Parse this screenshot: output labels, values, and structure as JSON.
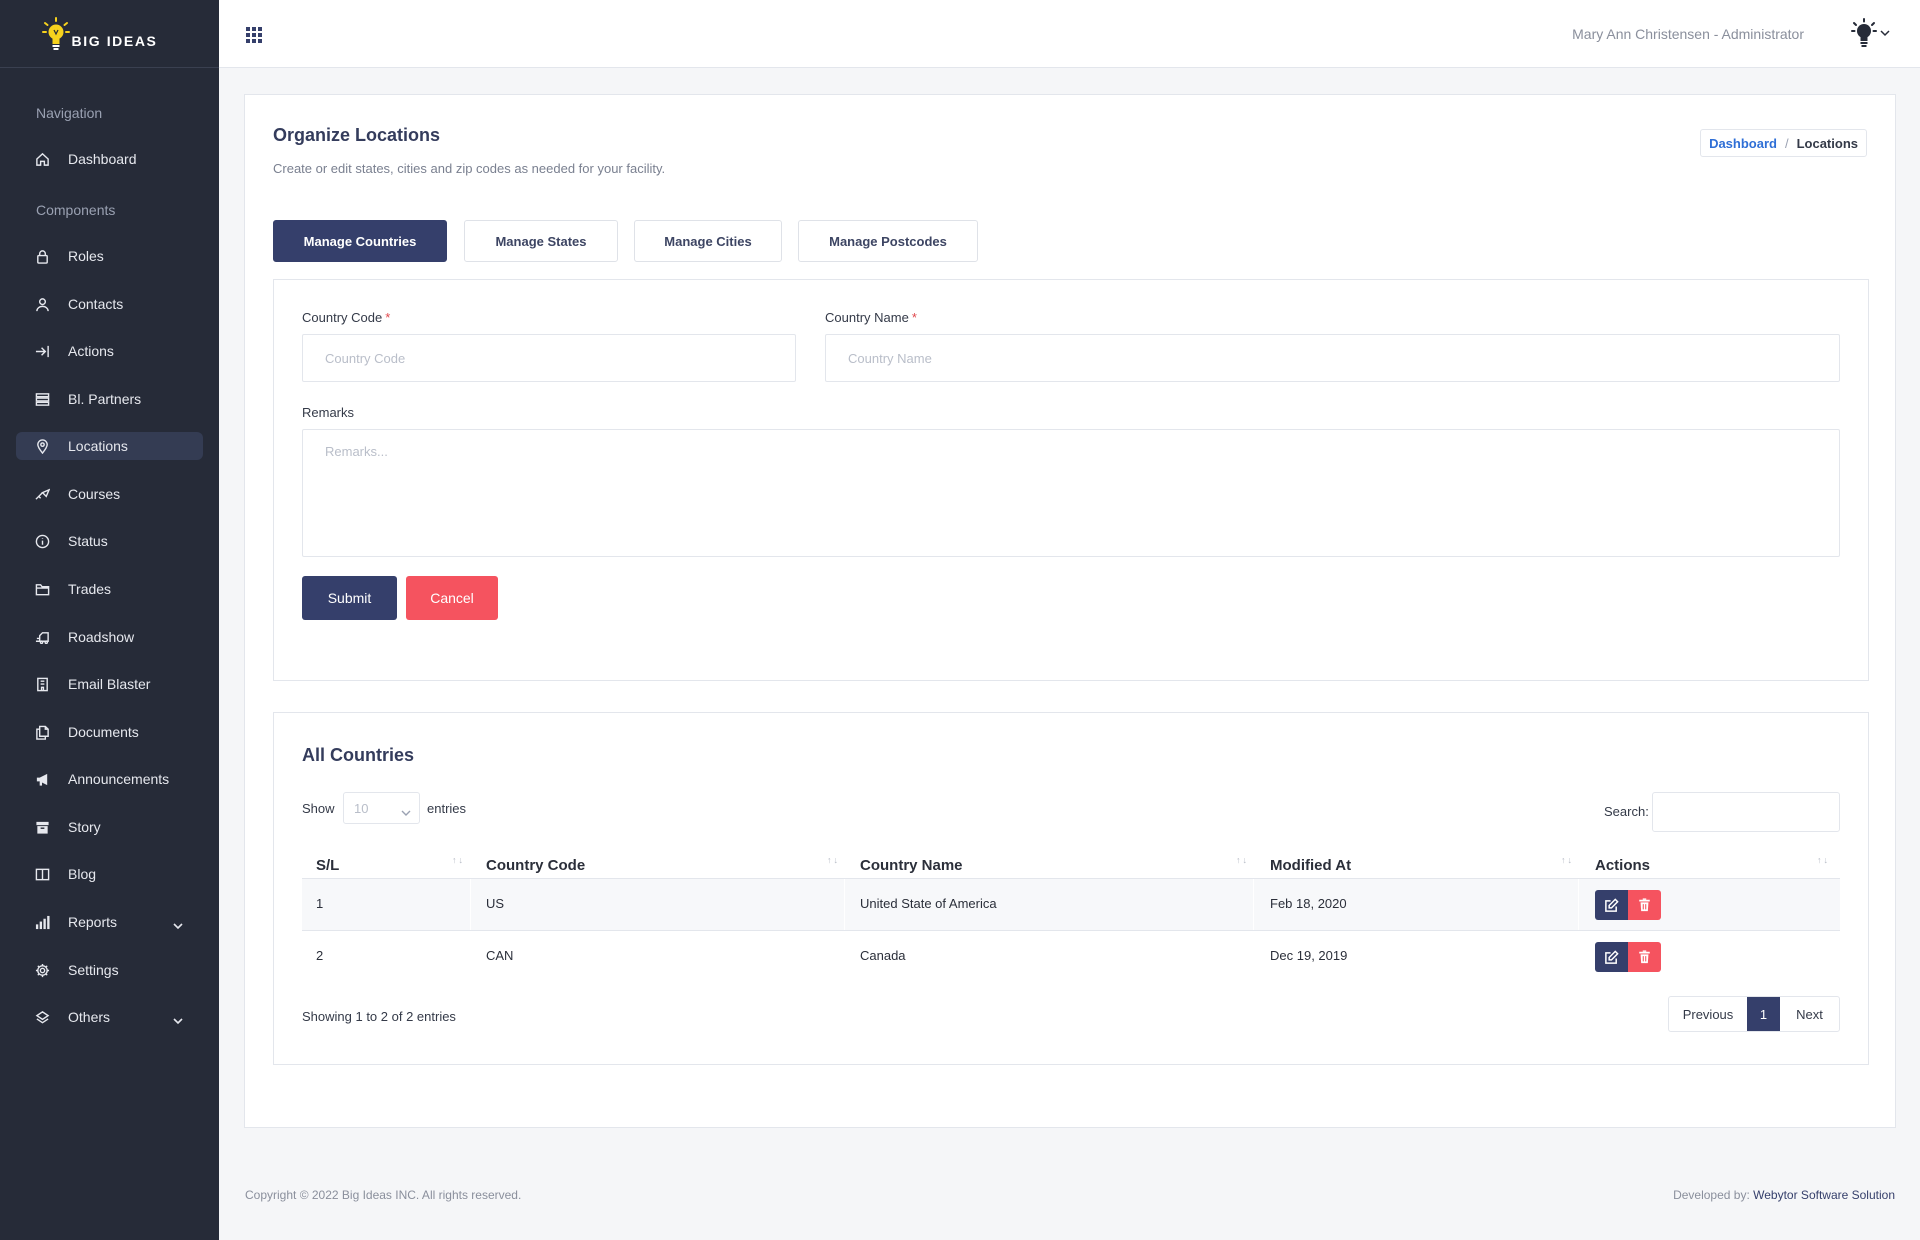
{
  "brand": {
    "name": "BIG IDEAS"
  },
  "topbar": {
    "menu_icon": "apps-grid-icon",
    "user": "Mary Ann Christensen - Administrator",
    "avatar_icon": "lightbulb-avatar-icon"
  },
  "sidebar": {
    "group_navigation": "Navigation",
    "group_components": "Components",
    "items": [
      {
        "label": "Dashboard",
        "icon": "home-icon"
      },
      {
        "label": "Roles",
        "icon": "lock-icon"
      },
      {
        "label": "Contacts",
        "icon": "user-icon"
      },
      {
        "label": "Actions",
        "icon": "arrow-right-bar-icon"
      },
      {
        "label": "Bl. Partners",
        "icon": "server-icon"
      },
      {
        "label": "Locations",
        "icon": "map-pin-icon",
        "active": true
      },
      {
        "label": "Courses",
        "icon": "graduation-icon"
      },
      {
        "label": "Status",
        "icon": "info-icon"
      },
      {
        "label": "Trades",
        "icon": "folder-icon"
      },
      {
        "label": "Roadshow",
        "icon": "truck-icon"
      },
      {
        "label": "Email Blaster",
        "icon": "building-icon"
      },
      {
        "label": "Documents",
        "icon": "documents-icon"
      },
      {
        "label": "Announcements",
        "icon": "megaphone-icon"
      },
      {
        "label": "Story",
        "icon": "archive-icon"
      },
      {
        "label": "Blog",
        "icon": "book-icon"
      },
      {
        "label": "Reports",
        "icon": "bar-chart-icon",
        "expandable": true
      },
      {
        "label": "Settings",
        "icon": "gear-icon"
      },
      {
        "label": "Others",
        "icon": "layers-icon",
        "expandable": true
      }
    ]
  },
  "page": {
    "title": "Organize Locations",
    "subtitle": "Create or edit states, cities and zip codes as needed for your facility.",
    "breadcrumb": {
      "link": "Dashboard",
      "separator": "/",
      "current": "Locations"
    }
  },
  "tabs": [
    {
      "label": "Manage Countries",
      "active": true
    },
    {
      "label": "Manage States"
    },
    {
      "label": "Manage Cities"
    },
    {
      "label": "Manage Postcodes"
    }
  ],
  "form": {
    "code_label": "Country Code",
    "code_placeholder": "Country Code",
    "name_label": "Country Name",
    "name_placeholder": "Country Name",
    "required_mark": "*",
    "remarks_label": "Remarks",
    "remarks_placeholder": "Remarks...",
    "submit": "Submit",
    "cancel": "Cancel"
  },
  "table": {
    "title": "All Countries",
    "show_label": "Show",
    "page_size": "10",
    "entries_label": "entries",
    "search_label": "Search:",
    "sort_glyph": "↑↓",
    "columns": [
      "S/L",
      "Country Code",
      "Country Name",
      "Modified At",
      "Actions"
    ],
    "rows": [
      {
        "sl": "1",
        "code": "US",
        "name": "United State of America",
        "modified": "Feb 18, 2020"
      },
      {
        "sl": "2",
        "code": "CAN",
        "name": "Canada",
        "modified": "Dec 19, 2019"
      }
    ],
    "info": "Showing 1 to 2 of 2 entries",
    "pagination": {
      "prev": "Previous",
      "current": "1",
      "next": "Next"
    }
  },
  "footer": {
    "copyright": "Copyright © 2022 Big Ideas INC. All rights reserved.",
    "developed_by_label": "Developed by:",
    "developer": "Webytor Software Solution"
  },
  "colors": {
    "sidebar_bg": "#262b38",
    "primary": "#353f6b",
    "danger": "#f5535f",
    "link": "#2f6fd6"
  }
}
